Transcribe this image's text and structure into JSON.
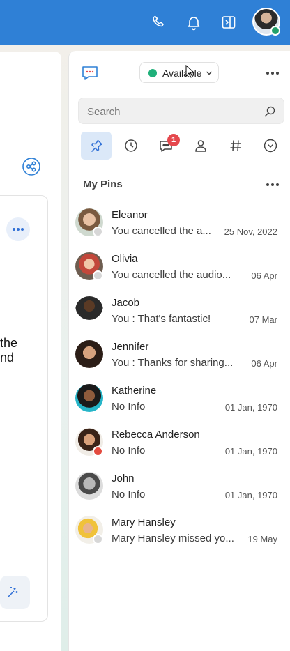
{
  "topbar": {
    "icons": [
      "phone-icon",
      "bell-icon",
      "side-panel-icon"
    ],
    "accent": "#2f80d6",
    "user_status_color": "#22a06b"
  },
  "left": {
    "text_line1": "the",
    "text_line2": "nd"
  },
  "panel": {
    "status": {
      "label": "Available",
      "color": "#1fb07a"
    },
    "search": {
      "placeholder": "Search"
    },
    "tabs": [
      {
        "name": "pin-icon",
        "active": true
      },
      {
        "name": "clock-icon"
      },
      {
        "name": "chat-icon",
        "badge": "1"
      },
      {
        "name": "person-icon"
      },
      {
        "name": "hash-icon"
      },
      {
        "name": "chevron-down-icon"
      }
    ],
    "section_title": "My Pins",
    "contacts": [
      {
        "name": "Eleanor",
        "message": "You cancelled the a...",
        "date": "25 Nov, 2022",
        "status": "offline"
      },
      {
        "name": "Olivia",
        "message": "You cancelled the audio...",
        "date": "06 Apr",
        "status": "offline"
      },
      {
        "name": "Jacob",
        "message": "You : That's fantastic!",
        "date": "07 Mar",
        "status": "none"
      },
      {
        "name": "Jennifer",
        "message": "You : Thanks for sharing...",
        "date": "06 Apr",
        "status": "none"
      },
      {
        "name": "Katherine",
        "message": "No Info",
        "date": "01 Jan, 1970",
        "status": "none"
      },
      {
        "name": "Rebecca Anderson",
        "message": "No Info",
        "date": "01 Jan, 1970",
        "status": "busy"
      },
      {
        "name": "John",
        "message": "No Info",
        "date": "01 Jan, 1970",
        "status": "none"
      },
      {
        "name": "Mary Hansley",
        "message": "Mary Hansley missed yo...",
        "date": "19 May",
        "status": "offline"
      }
    ]
  }
}
